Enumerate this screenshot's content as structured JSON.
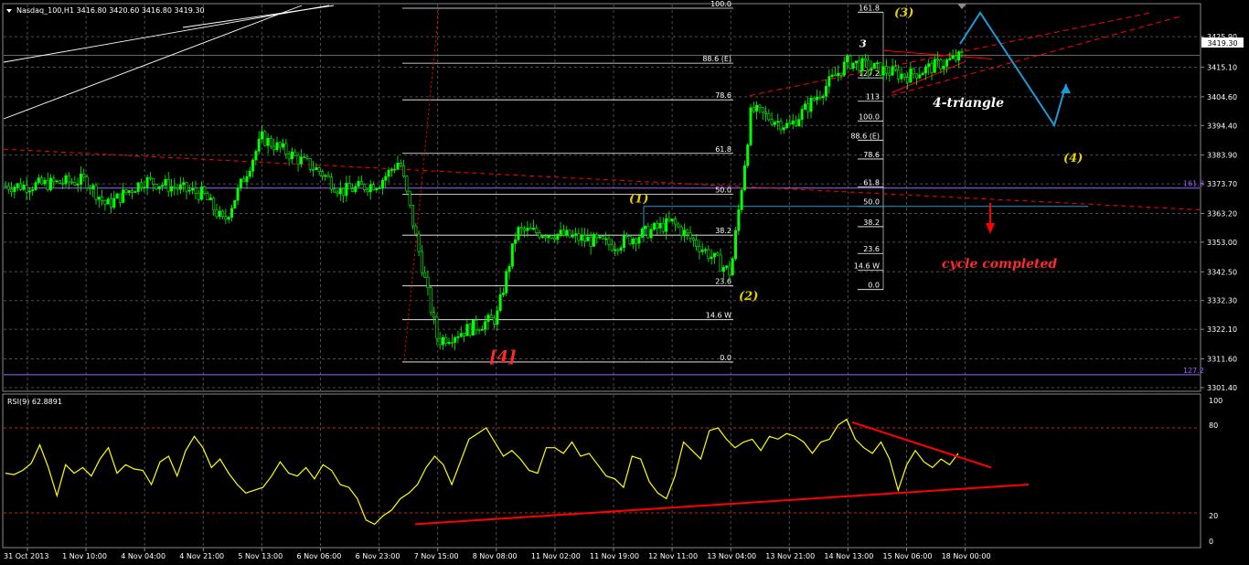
{
  "header": {
    "symbol_line": "Nasdaq_100,H1  3416.80 3420.60 3416.80 3419.30",
    "current_price": "3419.30"
  },
  "rsi": {
    "label": "RSI(9) 62.8891",
    "levels": [
      "100",
      "80",
      "20",
      "0"
    ]
  },
  "colors": {
    "background": "#000000",
    "grid": "#4d4d4d",
    "bull_candle": "#00ff00",
    "rsi_line": "#ffff00",
    "trendline": "#ff0000",
    "fib_line": "#ffffff",
    "wave_projection": "#1e9bd7",
    "level_161_8": "#9966ff"
  },
  "chart_data": [
    {
      "type": "candlestick",
      "title": "Nasdaq_100,H1",
      "y_ticks": [
        "3425.90",
        "3415.10",
        "3404.60",
        "3394.40",
        "3383.90",
        "3373.70",
        "3363.20",
        "3353.00",
        "3342.50",
        "3332.30",
        "3322.10",
        "3311.60",
        "3301.40"
      ],
      "ylim": [
        3301.4,
        3436.0
      ],
      "x_ticks": [
        "31 Oct 2013",
        "1 Nov 10:00",
        "4 Nov 04:00",
        "4 Nov 21:00",
        "5 Nov 13:00",
        "6 Nov 06:00",
        "6 Nov 23:00",
        "7 Nov 15:00",
        "8 Nov 08:00",
        "11 Nov 02:00",
        "11 Nov 19:00",
        "12 Nov 11:00",
        "13 Nov 04:00",
        "13 Nov 21:00",
        "14 Nov 13:00",
        "15 Nov 06:00",
        "18 Nov 00:00"
      ],
      "last_close": 3419.3,
      "approx_path": [
        [
          "31 Oct 2013",
          3373
        ],
        [
          "1 Nov 10:00",
          3375
        ],
        [
          "1 Nov 10:00",
          3366
        ],
        [
          "4 Nov 04:00",
          3375
        ],
        [
          "4 Nov 21:00",
          3370
        ],
        [
          "4 Nov 21:00",
          3360
        ],
        [
          "5 Nov 13:00",
          3390
        ],
        [
          "6 Nov 06:00",
          3378
        ],
        [
          "6 Nov 06:00",
          3371
        ],
        [
          "6 Nov 23:00",
          3374
        ],
        [
          "6 Nov 23:00",
          3382
        ],
        [
          "7 Nov 15:00",
          3318
        ],
        [
          "8 Nov 08:00",
          3326
        ],
        [
          "8 Nov 08:00",
          3357
        ],
        [
          "11 Nov 02:00",
          3356
        ],
        [
          "11 Nov 19:00",
          3352
        ],
        [
          "12 Nov 11:00",
          3360
        ],
        [
          "13 Nov 04:00",
          3342
        ],
        [
          "13 Nov 04:00",
          3400
        ],
        [
          "13 Nov 21:00",
          3394
        ],
        [
          "14 Nov 13:00",
          3417
        ],
        [
          "15 Nov 06:00",
          3412
        ],
        [
          "18 Nov 00:00",
          3419.3
        ]
      ],
      "fib_retracement_left": [
        {
          "label": "100.0",
          "price": 3436.0
        },
        {
          "label": "88.6 (E)",
          "price": 3416.5
        },
        {
          "label": "78.6",
          "price": 3403.5
        },
        {
          "label": "61.8",
          "price": 3384.5
        },
        {
          "label": "50.0",
          "price": 3370.0
        },
        {
          "label": "38.2",
          "price": 3355.5
        },
        {
          "label": "23.6",
          "price": 3337.5
        },
        {
          "label": "14.6 W",
          "price": 3325.5
        },
        {
          "label": "0.0",
          "price": 3310.5
        }
      ],
      "fib_retracement_right": [
        {
          "label": "161.8",
          "price": 3434.6
        },
        {
          "label": "127.2",
          "price": 3411.3
        },
        {
          "label": "113",
          "price": 3403.0
        },
        {
          "label": "100.0",
          "price": 3396.0
        },
        {
          "label": "88.6 (E)",
          "price": 3389.2
        },
        {
          "label": "78.6",
          "price": 3382.5
        },
        {
          "label": "61.8",
          "price": 3372.6
        },
        {
          "label": "50.0",
          "price": 3365.7
        },
        {
          "label": "38.2",
          "price": 3358.5
        },
        {
          "label": "23.6",
          "price": 3349.0
        },
        {
          "label": "14.6 W",
          "price": 3343.0
        },
        {
          "label": "0.0",
          "price": 3336.2
        }
      ],
      "horizontal_levels": [
        {
          "label": "161.8",
          "price": 3372.2
        },
        {
          "label": "127.2",
          "price": 3306.0
        }
      ],
      "annotations": [
        {
          "text": "(3)",
          "price": 3434.5
        },
        {
          "text": "3",
          "price": 3423.5
        },
        {
          "text": "4-triangle",
          "price": 3402.5
        },
        {
          "text": "(4)",
          "price": 3383.0
        },
        {
          "text": "(1)",
          "price": 3368.5
        },
        {
          "text": "cycle completed",
          "price": 3345.5
        },
        {
          "text": "(2)",
          "price": 3334.0
        },
        {
          "text": "[4]",
          "price": 3312.5
        }
      ]
    },
    {
      "type": "line",
      "title": "RSI(9) 62.8891",
      "series": [
        {
          "name": "RSI(9)",
          "last": 62.8891
        }
      ],
      "ylim": [
        0,
        100
      ],
      "levels": [
        80,
        20
      ],
      "approx_values": [
        48,
        47,
        50,
        55,
        68,
        52,
        32,
        54,
        48,
        52,
        46,
        58,
        66,
        48,
        54,
        51,
        50,
        40,
        56,
        60,
        46,
        64,
        74,
        66,
        52,
        58,
        48,
        40,
        34,
        36,
        38,
        46,
        56,
        48,
        46,
        52,
        44,
        54,
        50,
        40,
        38,
        30,
        15,
        12,
        18,
        22,
        30,
        34,
        40,
        52,
        60,
        54,
        40,
        56,
        72,
        76,
        80,
        70,
        60,
        64,
        58,
        50,
        48,
        66,
        66,
        62,
        70,
        60,
        62,
        54,
        46,
        44,
        38,
        60,
        58,
        42,
        34,
        30,
        46,
        70,
        64,
        58,
        78,
        80,
        72,
        66,
        70,
        72,
        64,
        74,
        72,
        76,
        74,
        70,
        62,
        70,
        72,
        82,
        86,
        72,
        66,
        62,
        70,
        58,
        36,
        54,
        64,
        56,
        52,
        58,
        54,
        62
      ]
    }
  ]
}
